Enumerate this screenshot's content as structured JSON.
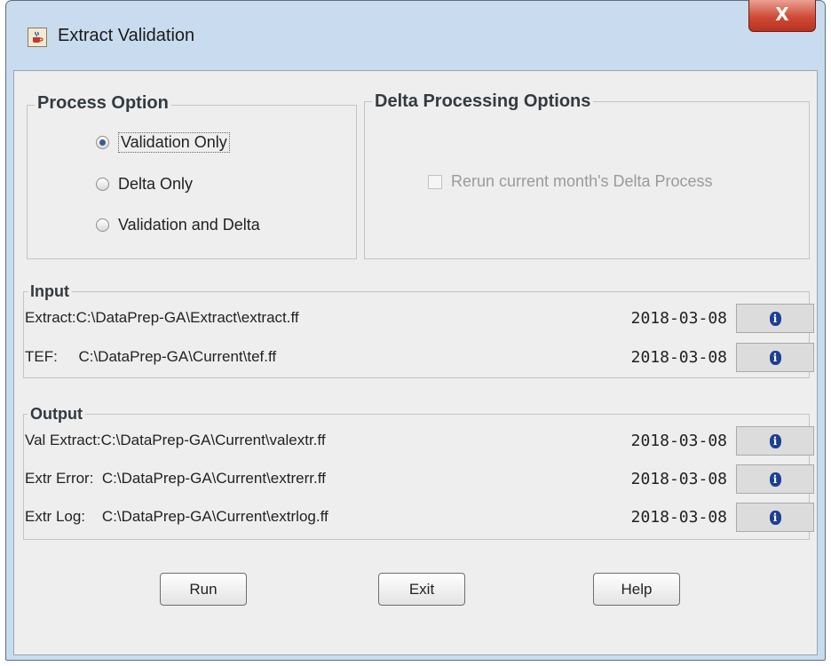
{
  "window": {
    "title": "Extract Validation",
    "close_label": "X"
  },
  "process_option": {
    "title": "Process Option",
    "options": [
      {
        "label": "Validation Only",
        "checked": true
      },
      {
        "label": "Delta Only",
        "checked": false
      },
      {
        "label": "Validation and Delta",
        "checked": false
      }
    ]
  },
  "delta_options": {
    "title": "Delta Processing Options",
    "rerun_label": "Rerun current month's Delta Process",
    "rerun_checked": false,
    "rerun_enabled": false
  },
  "input": {
    "title": "Input",
    "rows": [
      {
        "label": "Extract:C:\\DataPrep-GA\\Extract\\extract.ff",
        "date": "2018-03-08"
      },
      {
        "label": "TEF:     C:\\DataPrep-GA\\Current\\tef.ff",
        "date": "2018-03-08"
      }
    ]
  },
  "output": {
    "title": "Output",
    "rows": [
      {
        "label": "Val Extract:C:\\DataPrep-GA\\Current\\valextr.ff",
        "date": "2018-03-08"
      },
      {
        "label": "Extr Error:  C:\\DataPrep-GA\\Current\\extrerr.ff",
        "date": "2018-03-08"
      },
      {
        "label": "Extr Log:    C:\\DataPrep-GA\\Current\\extrlog.ff",
        "date": "2018-03-08"
      }
    ]
  },
  "buttons": {
    "run": "Run",
    "exit": "Exit",
    "help": "Help"
  },
  "icons": {
    "app": "java-cup-icon",
    "info": "info-icon"
  },
  "colors": {
    "title_bar": "#c9dcef",
    "close_button": "#cf4b37",
    "info_icon": "#1c3f94"
  }
}
